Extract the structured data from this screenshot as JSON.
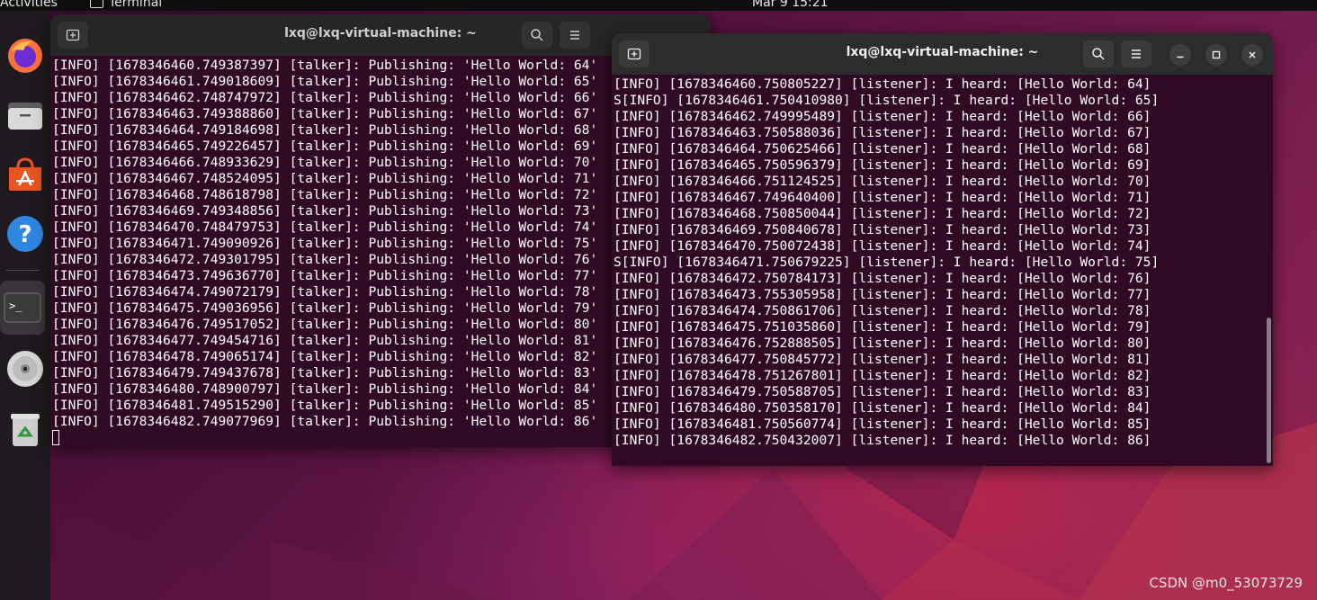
{
  "topbar": {
    "activities": "Activities",
    "app_name": "Terminal",
    "clock": "Mar 9  15:21"
  },
  "dock": {
    "items": [
      {
        "name": "firefox-icon"
      },
      {
        "name": "files-icon"
      },
      {
        "name": "app-center-icon"
      },
      {
        "name": "help-icon"
      },
      {
        "name": "terminal-icon"
      },
      {
        "name": "dvd-icon"
      },
      {
        "name": "trash-icon"
      }
    ]
  },
  "colors": {
    "terminal_bg": "#300a24",
    "titlebar": "#2c2c2c"
  },
  "window_left": {
    "title": "lxq@lxq-virtual-machine: ~",
    "lines": [
      "[INFO] [1678346460.749387397] [talker]: Publishing: 'Hello World: 64'",
      "[INFO] [1678346461.749018609] [talker]: Publishing: 'Hello World: 65'",
      "[INFO] [1678346462.748747972] [talker]: Publishing: 'Hello World: 66'",
      "[INFO] [1678346463.749388860] [talker]: Publishing: 'Hello World: 67'",
      "[INFO] [1678346464.749184698] [talker]: Publishing: 'Hello World: 68'",
      "[INFO] [1678346465.749226457] [talker]: Publishing: 'Hello World: 69'",
      "[INFO] [1678346466.748933629] [talker]: Publishing: 'Hello World: 70'",
      "[INFO] [1678346467.748524095] [talker]: Publishing: 'Hello World: 71'",
      "[INFO] [1678346468.748618798] [talker]: Publishing: 'Hello World: 72'",
      "[INFO] [1678346469.749348856] [talker]: Publishing: 'Hello World: 73'",
      "[INFO] [1678346470.748479753] [talker]: Publishing: 'Hello World: 74'",
      "[INFO] [1678346471.749090926] [talker]: Publishing: 'Hello World: 75'",
      "[INFO] [1678346472.749301795] [talker]: Publishing: 'Hello World: 76'",
      "[INFO] [1678346473.749636770] [talker]: Publishing: 'Hello World: 77'",
      "[INFO] [1678346474.749072179] [talker]: Publishing: 'Hello World: 78'",
      "[INFO] [1678346475.749036956] [talker]: Publishing: 'Hello World: 79'",
      "[INFO] [1678346476.749517052] [talker]: Publishing: 'Hello World: 80'",
      "[INFO] [1678346477.749454716] [talker]: Publishing: 'Hello World: 81'",
      "[INFO] [1678346478.749065174] [talker]: Publishing: 'Hello World: 82'",
      "[INFO] [1678346479.749437678] [talker]: Publishing: 'Hello World: 83'",
      "[INFO] [1678346480.748900797] [talker]: Publishing: 'Hello World: 84'",
      "[INFO] [1678346481.749515290] [talker]: Publishing: 'Hello World: 85'",
      "[INFO] [1678346482.749077969] [talker]: Publishing: 'Hello World: 86'"
    ]
  },
  "window_right": {
    "title": "lxq@lxq-virtual-machine: ~",
    "lines": [
      "[INFO] [1678346460.750805227] [listener]: I heard: [Hello World: 64]",
      "S[INFO] [1678346461.750410980] [listener]: I heard: [Hello World: 65]",
      "[INFO] [1678346462.749995489] [listener]: I heard: [Hello World: 66]",
      "[INFO] [1678346463.750588036] [listener]: I heard: [Hello World: 67]",
      "[INFO] [1678346464.750625466] [listener]: I heard: [Hello World: 68]",
      "[INFO] [1678346465.750596379] [listener]: I heard: [Hello World: 69]",
      "[INFO] [1678346466.751124525] [listener]: I heard: [Hello World: 70]",
      "[INFO] [1678346467.749640400] [listener]: I heard: [Hello World: 71]",
      "[INFO] [1678346468.750850044] [listener]: I heard: [Hello World: 72]",
      "[INFO] [1678346469.750840678] [listener]: I heard: [Hello World: 73]",
      "[INFO] [1678346470.750072438] [listener]: I heard: [Hello World: 74]",
      "S[INFO] [1678346471.750679225] [listener]: I heard: [Hello World: 75]",
      "[INFO] [1678346472.750784173] [listener]: I heard: [Hello World: 76]",
      "[INFO] [1678346473.755305958] [listener]: I heard: [Hello World: 77]",
      "[INFO] [1678346474.750861706] [listener]: I heard: [Hello World: 78]",
      "[INFO] [1678346475.751035860] [listener]: I heard: [Hello World: 79]",
      "[INFO] [1678346476.752888505] [listener]: I heard: [Hello World: 80]",
      "[INFO] [1678346477.750845772] [listener]: I heard: [Hello World: 81]",
      "[INFO] [1678346478.751267801] [listener]: I heard: [Hello World: 82]",
      "[INFO] [1678346479.750588705] [listener]: I heard: [Hello World: 83]",
      "[INFO] [1678346480.750358170] [listener]: I heard: [Hello World: 84]",
      "[INFO] [1678346481.750560774] [listener]: I heard: [Hello World: 85]",
      "[INFO] [1678346482.750432007] [listener]: I heard: [Hello World: 86]"
    ]
  },
  "watermark": "CSDN @m0_53073729"
}
